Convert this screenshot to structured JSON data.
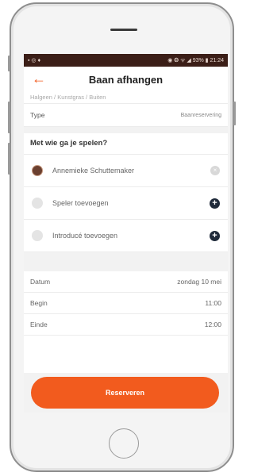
{
  "statusbar": {
    "left": "▪ ◎ ♦",
    "right": "◉ ❂ ᯤ ◢ 93% ▮ 21:24"
  },
  "appbar": {
    "back_icon": "←",
    "title": "Baan afhangen"
  },
  "subtitle": "Halgeen / Kunstgras / Buiten",
  "type_row": {
    "label": "Type",
    "value": "Baanreservering"
  },
  "players": {
    "section_title": "Met wie ga je spelen?",
    "items": [
      {
        "name": "Annemieke Schuttemaker",
        "action_icon": "×"
      },
      {
        "name": "Speler toevoegen",
        "action_icon": "+"
      },
      {
        "name": "Introducé toevoegen",
        "action_icon": "+"
      }
    ]
  },
  "details": [
    {
      "label": "Datum",
      "value": "zondag 10 mei"
    },
    {
      "label": "Begin",
      "value": "11:00"
    },
    {
      "label": "Einde",
      "value": "12:00"
    }
  ],
  "cta": {
    "label": "Reserveren"
  },
  "colors": {
    "accent": "#f25b1e",
    "statusbar": "#3b1e17",
    "add_button": "#1f2a3a"
  }
}
